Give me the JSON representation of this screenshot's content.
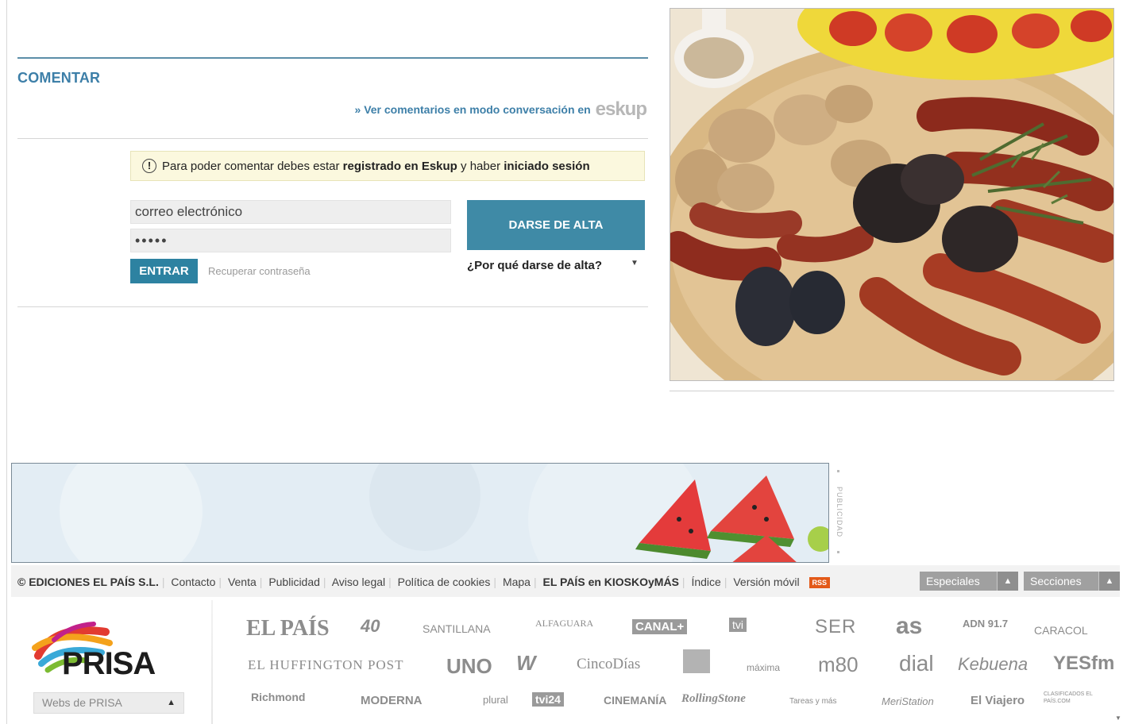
{
  "comment": {
    "title": "COMENTAR",
    "conversation_link": "» Ver comentarios en modo conversación en",
    "eskup_logo": "eskup",
    "notice": {
      "prefix": "Para poder comentar debes estar",
      "bold1": "registrado en Eskup",
      "middle": "y haber",
      "bold2": "iniciado sesión"
    },
    "email_placeholder": "correo electrónico",
    "password_mask": "•••••",
    "login_button": "ENTRAR",
    "recover_link": "Recuperar contraseña",
    "signup_button": "DARSE DE ALTA",
    "why_signup": "¿Por qué darse de alta?"
  },
  "advertising_label": "PUBLICIDAD",
  "footer": {
    "copyright": "© EDICIONES EL PAÍS S.L.",
    "links": [
      "Contacto",
      "Venta",
      "Publicidad",
      "Aviso legal",
      "Política de cookies",
      "Mapa"
    ],
    "kiosko_brand": "EL PAÍS",
    "kiosko_text": "en KIOSKOyMÁS",
    "links2": [
      "Índice",
      "Versión móvil"
    ],
    "rss": "RSS",
    "especiales": "Especiales",
    "secciones": "Secciones"
  },
  "prisa": {
    "logo_text": "PRISA",
    "webs_select": "Webs de PRISA",
    "row1": [
      "EL PAÍS",
      "40",
      "SANTILLANA",
      "ALFAGUARA",
      "CANAL+",
      "tvi",
      "SER",
      "as",
      "ADN 91.7",
      "CARACOL"
    ],
    "row2": [
      "EL HUFFINGTON POST",
      "UNO",
      "W",
      "CincoDías",
      "máxima",
      "m80",
      "dial",
      "Kebuena",
      "YESfm"
    ],
    "row3": [
      "Richmond",
      "MODERNA",
      "plural",
      "tvi24",
      "CINEMANÍA",
      "RollingStone",
      "Tareas y más",
      "MeriStation",
      "El Viajero",
      "CLASIFICADOS EL PAÍS.COM"
    ]
  },
  "colors": {
    "accent": "#3d7fa8",
    "button": "#2d82a1",
    "rss": "#e35a19"
  }
}
